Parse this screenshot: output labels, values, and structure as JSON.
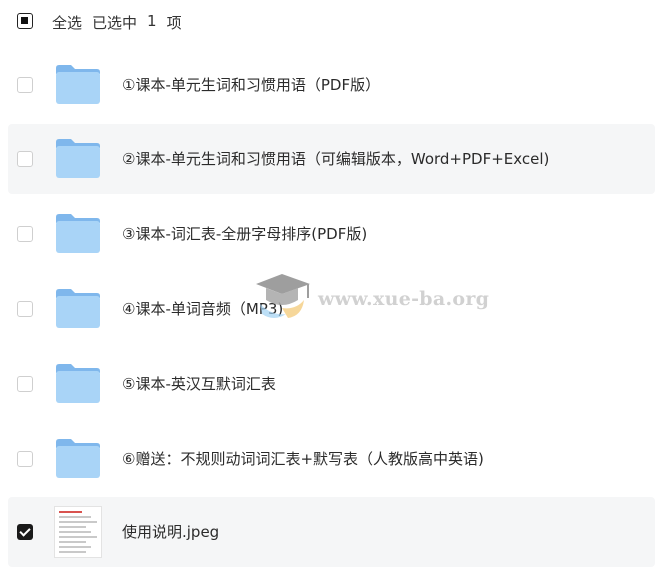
{
  "header": {
    "select_all": "全选",
    "selected_prefix": "已选中",
    "selected_count": "1",
    "selected_suffix": "项"
  },
  "files": [
    {
      "name": "①课本-单元生词和习惯用语（PDF版）",
      "type": "folder",
      "checked": false
    },
    {
      "name": "②课本-单元生词和习惯用语（可编辑版本，Word+PDF+Excel)",
      "type": "folder",
      "checked": false
    },
    {
      "name": "③课本-词汇表-全册字母排序(PDF版)",
      "type": "folder",
      "checked": false
    },
    {
      "name": "④课本-单词音频（MP3)",
      "type": "folder",
      "checked": false
    },
    {
      "name": "⑤课本-英汉互默词汇表",
      "type": "folder",
      "checked": false
    },
    {
      "name": "⑥赠送：不规则动词词汇表+默写表（人教版高中英语)",
      "type": "folder",
      "checked": false
    },
    {
      "name": "使用说明.jpeg",
      "type": "image",
      "checked": true
    }
  ],
  "watermark": {
    "text": "www.xue-ba.org"
  },
  "colors": {
    "folder_light": "#a9d4f7",
    "folder_dark": "#7fb7ec",
    "row_alt_bg": "#f5f6f7",
    "check_dark": "#1a1a1a"
  }
}
